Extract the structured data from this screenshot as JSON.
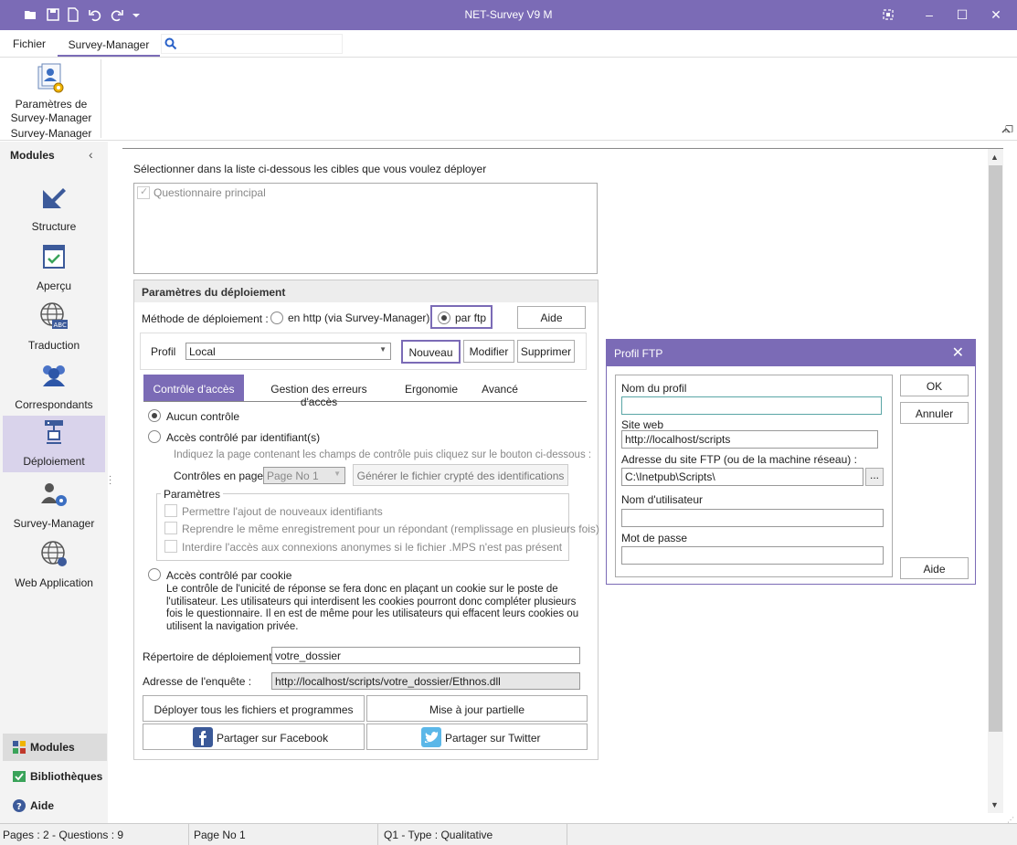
{
  "titlebar": {
    "title": "NET-Survey V9 M",
    "accent": "#7b6bb6"
  },
  "menu": {
    "file": "Fichier",
    "survey_manager": "Survey-Manager"
  },
  "ribbon": {
    "button_label_1": "Paramètres de",
    "button_label_2": "Survey-Manager",
    "group_label": "Survey-Manager"
  },
  "sidebar": {
    "header": "Modules",
    "items": [
      {
        "label": "Structure"
      },
      {
        "label": "Aperçu"
      },
      {
        "label": "Traduction"
      },
      {
        "label": "Correspondants"
      },
      {
        "label": "Déploiement"
      },
      {
        "label": "Survey-Manager"
      },
      {
        "label": "Web Application"
      }
    ],
    "bottom": [
      {
        "label": "Modules"
      },
      {
        "label": "Bibliothèques"
      },
      {
        "label": "Aide"
      }
    ]
  },
  "targets": {
    "instruction": "Sélectionner dans la liste ci-dessous les cibles que vous voulez déployer",
    "items": [
      {
        "label": "Questionnaire principal"
      }
    ]
  },
  "deploy": {
    "header": "Paramètres du déploiement",
    "method_label": "Méthode de déploiement :",
    "http_option": "en http (via Survey-Manager)",
    "ftp_option": "par ftp",
    "help": "Aide",
    "profile_label": "Profil",
    "profile_value": "Local",
    "new": "Nouveau",
    "modify": "Modifier",
    "delete": "Supprimer",
    "tabs": [
      "Contrôle d'accès",
      "Gestion des erreurs d'accès",
      "Ergonomie",
      "Avancé"
    ],
    "access": {
      "none": "Aucun contrôle",
      "by_id": "Accès contrôlé par identifiant(s)",
      "indication": "Indiquez la page contenant les champs de contrôle puis cliquez sur le bouton ci-dessous :",
      "controls_label": "Contrôles en page :",
      "page_value": "Page No 1",
      "generate": "Générer le fichier crypté des identifications",
      "params_legend": "Paramètres",
      "opt1": "Permettre l'ajout de nouveaux identifiants",
      "opt2": "Reprendre le même enregistrement pour un répondant (remplissage en plusieurs fois)",
      "opt3": "Interdire l'accès aux connexions anonymes si le fichier .MPS n'est pas présent",
      "by_cookie": "Accès contrôlé par cookie",
      "cookie_l1": "Le contrôle de l'unicité de réponse se fera donc en plaçant un cookie sur le poste de",
      "cookie_l2": "l'utilisateur. Les utilisateurs qui interdisent les cookies pourront donc compléter plusieurs",
      "cookie_l3": "fois le questionnaire. Il en est de même pour les utilisateurs qui effacent leurs cookies ou",
      "cookie_l4": "utilisent la navigation privée."
    },
    "dir_label": "Répertoire de déploiement :",
    "dir_value": "votre_dossier",
    "url_label": "Adresse de l'enquête :",
    "url_value": "http://localhost/scripts/votre_dossier/Ethnos.dll",
    "deploy_all": "Déployer tous les fichiers et programmes",
    "partial": "Mise à jour partielle",
    "facebook": "Partager sur Facebook",
    "twitter": "Partager sur Twitter"
  },
  "ftp_dialog": {
    "title": "Profil FTP",
    "profile_name_label": "Nom du profil",
    "profile_name_value": "",
    "website_label": "Site web",
    "website_value": "http://localhost/scripts",
    "ftp_label": "Adresse du site FTP (ou de la machine réseau) :",
    "ftp_value": "C:\\Inetpub\\Scripts\\",
    "browse": "...",
    "user_label": "Nom d'utilisateur",
    "user_value": "",
    "password_label": "Mot de passe",
    "password_value": "",
    "ok": "OK",
    "cancel": "Annuler",
    "help": "Aide"
  },
  "status": {
    "pages": "Pages : 2 - Questions : 9",
    "page": "Page No 1",
    "question": "Q1 - Type : Qualitative"
  }
}
